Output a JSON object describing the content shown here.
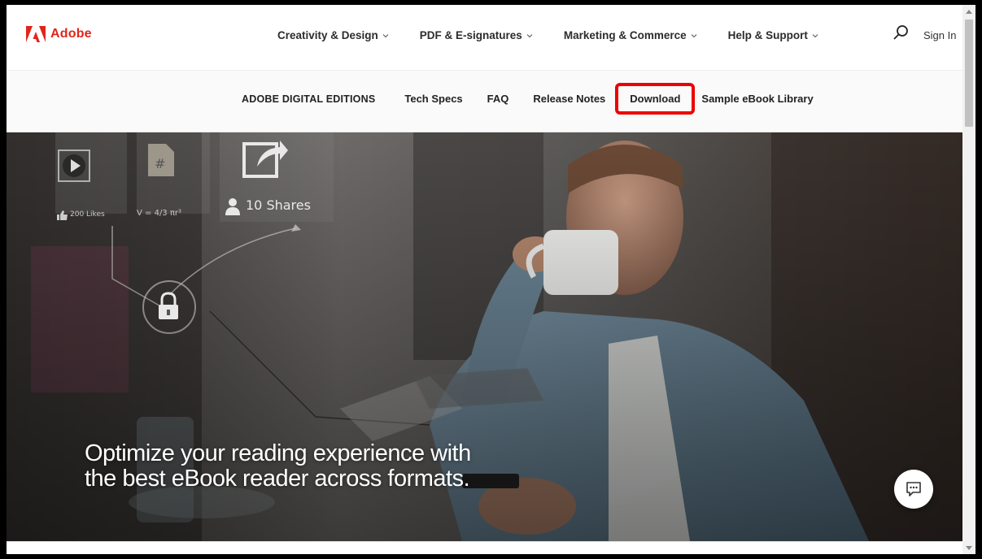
{
  "header": {
    "logo_text": "Adobe",
    "nav": [
      {
        "label": "Creativity & Design"
      },
      {
        "label": "PDF & E-signatures"
      },
      {
        "label": "Marketing & Commerce"
      },
      {
        "label": "Help & Support"
      }
    ],
    "sign_in": "Sign In"
  },
  "subnav": {
    "brand": "ADOBE DIGITAL EDITIONS",
    "items": [
      "Tech Specs",
      "FAQ",
      "Release Notes",
      "Download",
      "Sample eBook Library"
    ],
    "highlighted": "Download"
  },
  "hero": {
    "headline_line1": "Optimize your reading experience with",
    "headline_line2": "the best eBook reader across formats.",
    "overlay_shares": "10 Shares",
    "overlay_likes": "200 Likes",
    "overlay_formula": "V = 4/3 πr³"
  },
  "colors": {
    "brand_red": "#e1251b",
    "highlight_red": "#ee0000"
  },
  "icons": [
    "adobe-logo-icon",
    "chevron-down-icon",
    "search-icon",
    "chat-icon",
    "play-icon",
    "file-hash-icon",
    "share-icon",
    "lock-icon",
    "user-icon",
    "thumbs-up-icon"
  ]
}
